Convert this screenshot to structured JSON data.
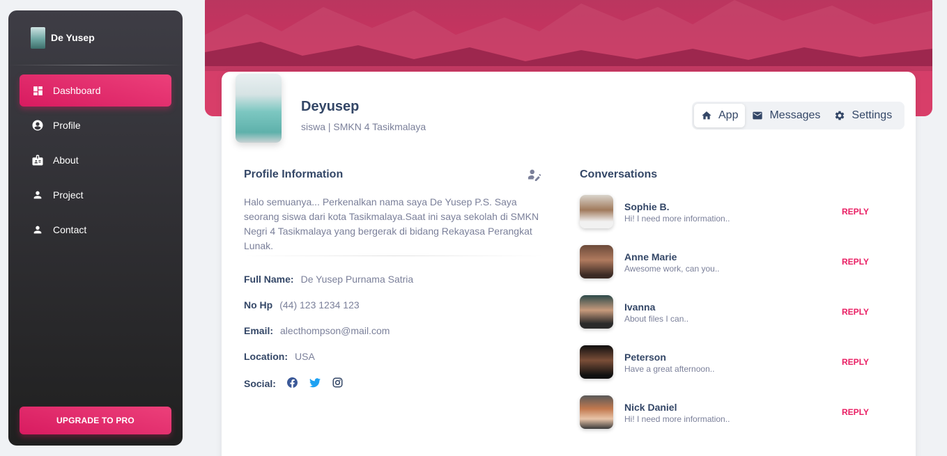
{
  "sidebar": {
    "brand": "De Yusep",
    "items": [
      {
        "label": "Dashboard",
        "icon": "dashboard-icon",
        "active": true
      },
      {
        "label": "Profile",
        "icon": "account-circle-icon"
      },
      {
        "label": "About",
        "icon": "badge-icon"
      },
      {
        "label": "Project",
        "icon": "person-icon"
      },
      {
        "label": "Contact",
        "icon": "person-icon"
      }
    ],
    "upgrade_label": "UPGRADE TO PRO"
  },
  "profile": {
    "name": "Deyusep",
    "subtitle": "siswa | SMKN 4 Tasikmalaya"
  },
  "tabs": [
    {
      "label": "App",
      "icon": "home-icon",
      "active": true
    },
    {
      "label": "Messages",
      "icon": "email-icon"
    },
    {
      "label": "Settings",
      "icon": "gear-icon"
    }
  ],
  "profile_info": {
    "title": "Profile Information",
    "bio": "Halo semuanya... Perkenalkan nama saya De Yusep P.S. Saya seorang siswa dari kota Tasikmalaya.Saat ini saya sekolah di SMKN Negri 4 Tasikmalaya yang bergerak di bidang Rekayasa Perangkat Lunak.",
    "fields": [
      {
        "label": "Full Name:",
        "value": "De Yusep Purnama Satria"
      },
      {
        "label": "No Hp",
        "value": "(44) 123 1234 123"
      },
      {
        "label": "Email:",
        "value": "alecthompson@mail.com"
      },
      {
        "label": "Location:",
        "value": "USA"
      }
    ],
    "social_label": "Social:",
    "social_icons": [
      "facebook-icon",
      "twitter-icon",
      "instagram-icon"
    ]
  },
  "conversations": {
    "title": "Conversations",
    "reply_label": "REPLY",
    "items": [
      {
        "name": "Sophie B.",
        "message": "Hi! I need more information.."
      },
      {
        "name": "Anne Marie",
        "message": "Awesome work, can you.."
      },
      {
        "name": "Ivanna",
        "message": "About files I can.."
      },
      {
        "name": "Peterson",
        "message": "Have a great afternoon.."
      },
      {
        "name": "Nick Daniel",
        "message": "Hi! I need more information.."
      }
    ]
  },
  "colors": {
    "accent": "#e91e63",
    "sidebar_top": "#3e3d45",
    "sidebar_bottom": "#202020",
    "text_dark": "#344767",
    "text_muted": "#7b809a"
  }
}
